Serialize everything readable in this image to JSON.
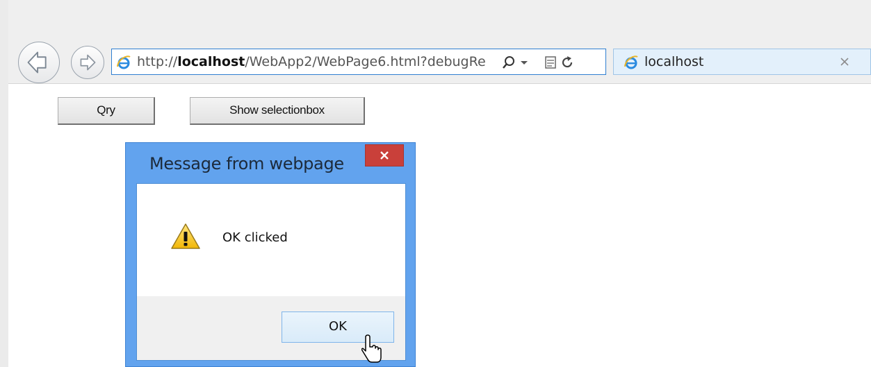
{
  "browser": {
    "address_bar": {
      "url_prefix": "http://",
      "url_host": "localhost",
      "url_path": "/WebApp2/WebPage6.html?debugRe"
    },
    "tab": {
      "title": "localhost"
    },
    "icons": {
      "back": "back-arrow-icon",
      "forward": "forward-arrow-icon",
      "site": "internet-explorer-icon",
      "search": "search-icon",
      "dropdown": "dropdown-arrow-icon",
      "compat": "compatibility-view-icon",
      "refresh": "refresh-icon",
      "close_tab": "close-icon"
    }
  },
  "page": {
    "buttons": {
      "qry": "Qry",
      "show_selectionbox": "Show selectionbox"
    }
  },
  "dialog": {
    "title": "Message from webpage",
    "message": "OK clicked",
    "ok_label": "OK",
    "icon": "warning-icon"
  },
  "colors": {
    "dialog_frame": "#62a3ee",
    "dialog_close": "#c9403a",
    "address_border": "#2f7fd1",
    "tab_background": "#e3f0fb"
  }
}
